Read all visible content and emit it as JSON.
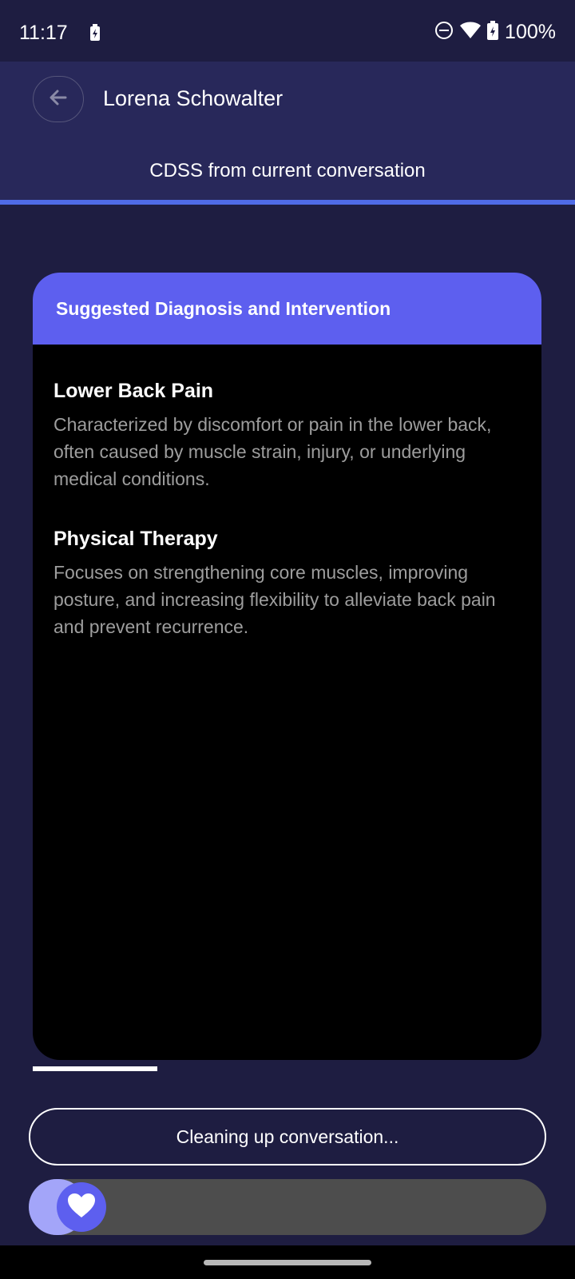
{
  "status_bar": {
    "time": "11:17",
    "battery_text": "100%",
    "icons": [
      "battery-charging-icon",
      "do-not-disturb-icon",
      "wifi-icon",
      "battery-icon"
    ]
  },
  "header": {
    "back_icon": "arrow-left-icon",
    "title": "Lorena Schowalter",
    "subtitle": "CDSS from current conversation"
  },
  "card": {
    "header": "Suggested Diagnosis and Intervention",
    "items": [
      {
        "title": "Lower Back Pain",
        "description": "Characterized by discomfort or pain in the lower back, often caused by muscle strain, injury, or underlying medical conditions."
      },
      {
        "title": "Physical Therapy",
        "description": "Focuses on strengthening core muscles, improving posture, and increasing flexibility to alleviate back pain and prevent recurrence."
      }
    ]
  },
  "status_button": {
    "label": "Cleaning up conversation..."
  },
  "slider": {
    "icon": "heart-icon",
    "position": 0
  },
  "colors": {
    "background": "#1e1d41",
    "header_bg": "#28285a",
    "accent": "#5d5fef",
    "underline": "#4f6be6",
    "card_bg": "#000000",
    "muted_text": "#9d9d9d"
  }
}
